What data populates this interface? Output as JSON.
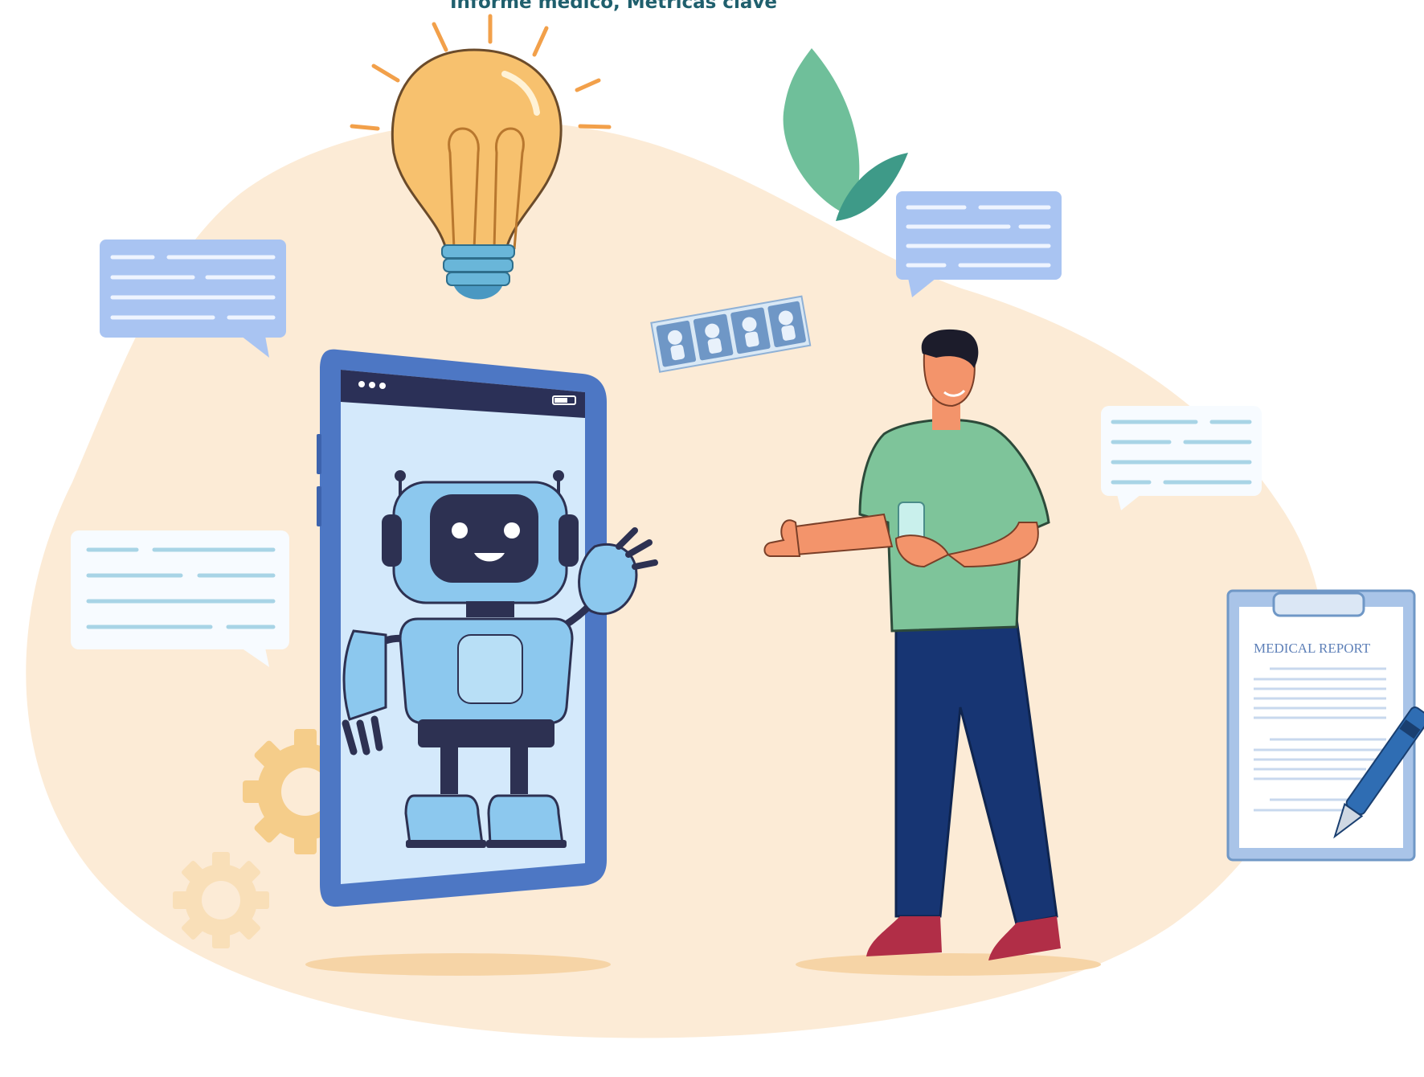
{
  "header": {
    "text": "Informe médico, Métricas clave"
  },
  "report": {
    "title": "MEDICAL REPORT"
  },
  "colors": {
    "blob": "#fcebd6",
    "bubble_blue": "#a9c4f2",
    "bubble_white": "#f7fbff",
    "phone_frame": "#4d77c4",
    "robot": "#8cc8ee",
    "robot_dark": "#2d3152",
    "shirt": "#7ec49a",
    "pants": "#173573",
    "bulb": "#f7c16e",
    "leaf": "#6fbf9a",
    "gear": "#f5cd8a",
    "header_text": "#1f5f6d"
  },
  "icons": [
    "light-bulb-icon",
    "chat-bubble-icon",
    "gear-icon",
    "leaf-icon",
    "robot-icon",
    "smartphone-icon",
    "clipboard-icon",
    "pen-icon",
    "xray-film-icon"
  ]
}
